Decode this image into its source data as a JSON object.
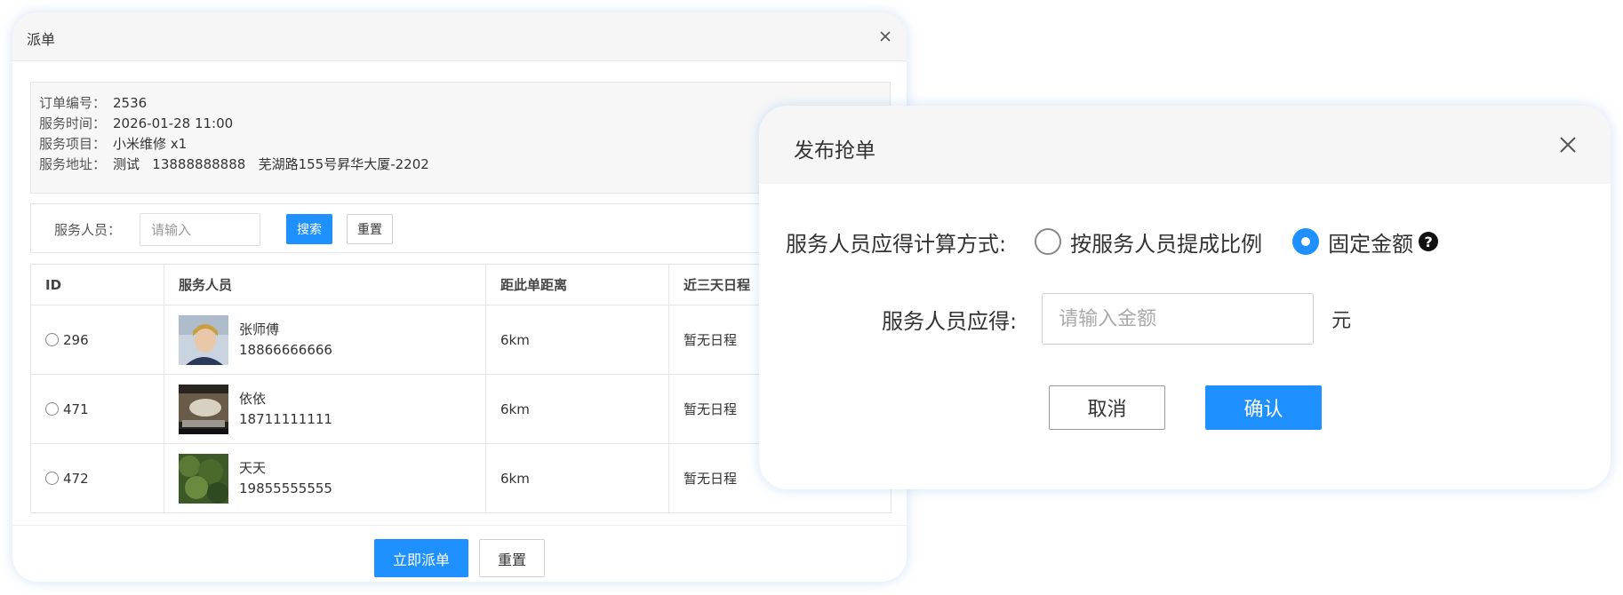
{
  "dispatch_dialog": {
    "title": "派单",
    "order": [
      {
        "label": "订单编号：",
        "value": "2536"
      },
      {
        "label": "服务时间：",
        "value": "2026-01-28 11:00"
      },
      {
        "label": "服务项目：",
        "value": "小米维修 x1"
      },
      {
        "label": "服务地址：",
        "value": "测试   13888888888   芜湖路155号昇华大厦-2202"
      }
    ],
    "search": {
      "label": "服务人员：",
      "placeholder": "请输入",
      "search_btn": "搜索",
      "reset_btn": "重置"
    },
    "table": {
      "headers": [
        "ID",
        "服务人员",
        "距此单距离",
        "近三天日程"
      ],
      "rows": [
        {
          "id": "296",
          "name": "张师傅",
          "phone": "18866666666",
          "distance": "6km",
          "schedule": "暂无日程"
        },
        {
          "id": "471",
          "name": "依依",
          "phone": "18711111111",
          "distance": "6km",
          "schedule": "暂无日程"
        },
        {
          "id": "472",
          "name": "天天",
          "phone": "19855555555",
          "distance": "6km",
          "schedule": "暂无日程"
        }
      ]
    },
    "footer": {
      "dispatch_btn": "立即派单",
      "reset_btn": "重置"
    }
  },
  "grab_dialog": {
    "title": "发布抢单",
    "calc_label": "服务人员应得计算方式:",
    "option_ratio": "按服务人员提成比例",
    "option_fixed": "固定金额",
    "selected_option": "固定金额",
    "amount_label": "服务人员应得:",
    "amount_placeholder": "请输入金额",
    "amount_unit": "元",
    "cancel_btn": "取消",
    "confirm_btn": "确认"
  },
  "colors": {
    "primary": "#1e90ff",
    "header_bg": "#f6f6f6"
  }
}
